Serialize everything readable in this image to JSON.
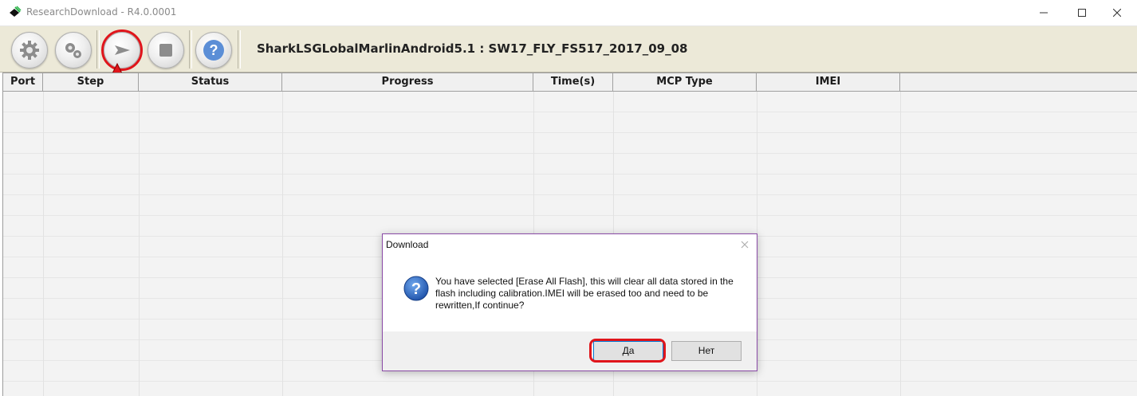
{
  "window": {
    "title": "ResearchDownload - R4.0.0001",
    "controls": [
      "minimize",
      "maximize",
      "close"
    ]
  },
  "toolbar": {
    "buttons": [
      {
        "icon": "gear-icon",
        "label": ""
      },
      {
        "icon": "gears-icon",
        "label": ""
      },
      {
        "icon": "play-icon",
        "label": ""
      },
      {
        "icon": "stop-icon",
        "label": ""
      },
      {
        "icon": "help-icon",
        "label": ""
      }
    ],
    "firmware_title": "SharkLSGLobalMarlinAndroid5.1 : SW17_FLY_FS517_2017_09_08"
  },
  "grid": {
    "columns": [
      "Port",
      "Step",
      "Status",
      "Progress",
      "Time(s)",
      "MCP Type",
      "IMEI"
    ],
    "rows": []
  },
  "dialog": {
    "title": "Download",
    "icon": "question-icon",
    "message": "You have selected [Erase All Flash], this will clear all data stored in the flash including calibration.IMEI will be erased too and need to be rewritten,If continue?",
    "yes_label": "Да",
    "no_label": "Нет"
  },
  "colors": {
    "toolbar_bg": "#ece9d8",
    "highlight": "#e0151b",
    "dialog_border": "#8a4aa6"
  }
}
